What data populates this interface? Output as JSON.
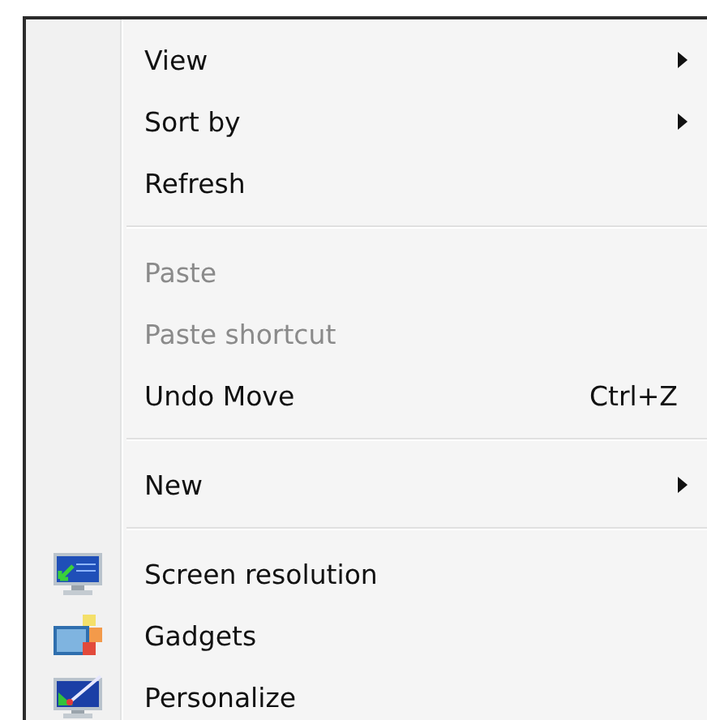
{
  "context_menu": {
    "items": [
      {
        "kind": "submenu",
        "label": "View",
        "disabled": false
      },
      {
        "kind": "submenu",
        "label": "Sort by",
        "disabled": false
      },
      {
        "kind": "command",
        "label": "Refresh",
        "disabled": false
      },
      {
        "kind": "separator"
      },
      {
        "kind": "command",
        "label": "Paste",
        "disabled": true
      },
      {
        "kind": "command",
        "label": "Paste shortcut",
        "disabled": true
      },
      {
        "kind": "command",
        "label": "Undo Move",
        "disabled": false,
        "shortcut": "Ctrl+Z"
      },
      {
        "kind": "separator"
      },
      {
        "kind": "submenu",
        "label": "New",
        "disabled": false
      },
      {
        "kind": "separator"
      },
      {
        "kind": "icon-command",
        "label": "Screen resolution",
        "disabled": false
      },
      {
        "kind": "icon-command",
        "label": "Gadgets",
        "disabled": false
      },
      {
        "kind": "icon-command",
        "label": "Personalize",
        "disabled": false
      }
    ]
  }
}
